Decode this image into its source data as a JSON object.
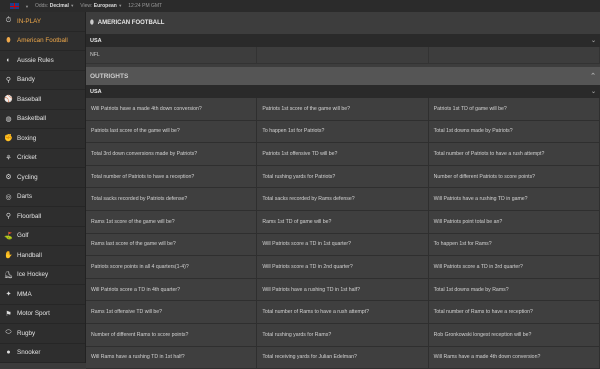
{
  "topbar": {
    "odds_label": "Odds:",
    "odds_value": "Decimal",
    "view_label": "View:",
    "view_value": "European",
    "time": "12:24 PM GMT"
  },
  "sidebar": {
    "items": [
      {
        "label": "IN-PLAY",
        "icon": "inplay-icon"
      },
      {
        "label": "American Football",
        "icon": "american-football-icon"
      },
      {
        "label": "Aussie Rules",
        "icon": "aussie-rules-icon"
      },
      {
        "label": "Bandy",
        "icon": "bandy-icon"
      },
      {
        "label": "Baseball",
        "icon": "baseball-icon"
      },
      {
        "label": "Basketball",
        "icon": "basketball-icon"
      },
      {
        "label": "Boxing",
        "icon": "boxing-icon"
      },
      {
        "label": "Cricket",
        "icon": "cricket-icon"
      },
      {
        "label": "Cycling",
        "icon": "cycling-icon"
      },
      {
        "label": "Darts",
        "icon": "darts-icon"
      },
      {
        "label": "Floorball",
        "icon": "floorball-icon"
      },
      {
        "label": "Golf",
        "icon": "golf-icon"
      },
      {
        "label": "Handball",
        "icon": "handball-icon"
      },
      {
        "label": "Ice Hockey",
        "icon": "ice-hockey-icon"
      },
      {
        "label": "MMA",
        "icon": "mma-icon"
      },
      {
        "label": "Motor Sport",
        "icon": "motor-sport-icon"
      },
      {
        "label": "Rugby",
        "icon": "rugby-icon"
      },
      {
        "label": "Snooker",
        "icon": "snooker-icon"
      }
    ]
  },
  "main": {
    "title": "AMERICAN FOOTBALL",
    "section1": "USA",
    "nfl": "NFL",
    "outrights": "OUTRIGHTS",
    "section2": "USA",
    "markets": [
      "Will Patriots have a made 4th down conversion?",
      "Patriots 1st score of the game will be?",
      "Patriots 1st TD of game will be?",
      "Patriots last score of the game will be?",
      "To happen 1st for Patriots?",
      "Total 1st downs made by Patriots?",
      "Total 3rd down conversions made by Patriots?",
      "Patriots 1st offensive TD will be?",
      "Total number of Patriots to have a rush attempt?",
      "Total number of Patriots to have a reception?",
      "Total rushing yards for Patriots?",
      "Number of different Patriots to score points?",
      "Total sacks recorded by Patriots defense?",
      "Total sacks recorded by Rams defense?",
      "Will Patriots have a rushing TD in game?",
      "Rams 1st score of the game will be?",
      "Rams 1st TD of game will be?",
      "Will Patriots point total be an?",
      "Rams last score of the game will be?",
      "Will Patriots score a TD in 1st quarter?",
      "To happen 1st for Rams?",
      "Patriots score points in all 4 quarters(1-4)?",
      "Will Patriots score a TD in 2nd quarter?",
      "Will Patriots score a TD in 3rd quarter?",
      "Will Patriots score a TD in 4th quarter?",
      "Will Patriots have a rushing TD in 1st half?",
      "Total 1st downs made by Rams?",
      "Rams 1st offensive TD will be?",
      "Total number of Rams to have a rush attempt?",
      "Total number of Rams to have a reception?",
      "Number of different Rams to score points?",
      "Total rushing yards for Rams?",
      "Rob Gronkowski longest reception will be?",
      "Will Rams have a rushing TD in 1st half?",
      "Total receiving yards for Julian Edelman?",
      "Will Rams have a made 4th down conversion?"
    ]
  },
  "colors": {
    "accent": "#f0a94a",
    "sidebar_bg": "#2e2e2e",
    "section_bg": "#2a2a2a",
    "outrights_bg": "#555555"
  }
}
